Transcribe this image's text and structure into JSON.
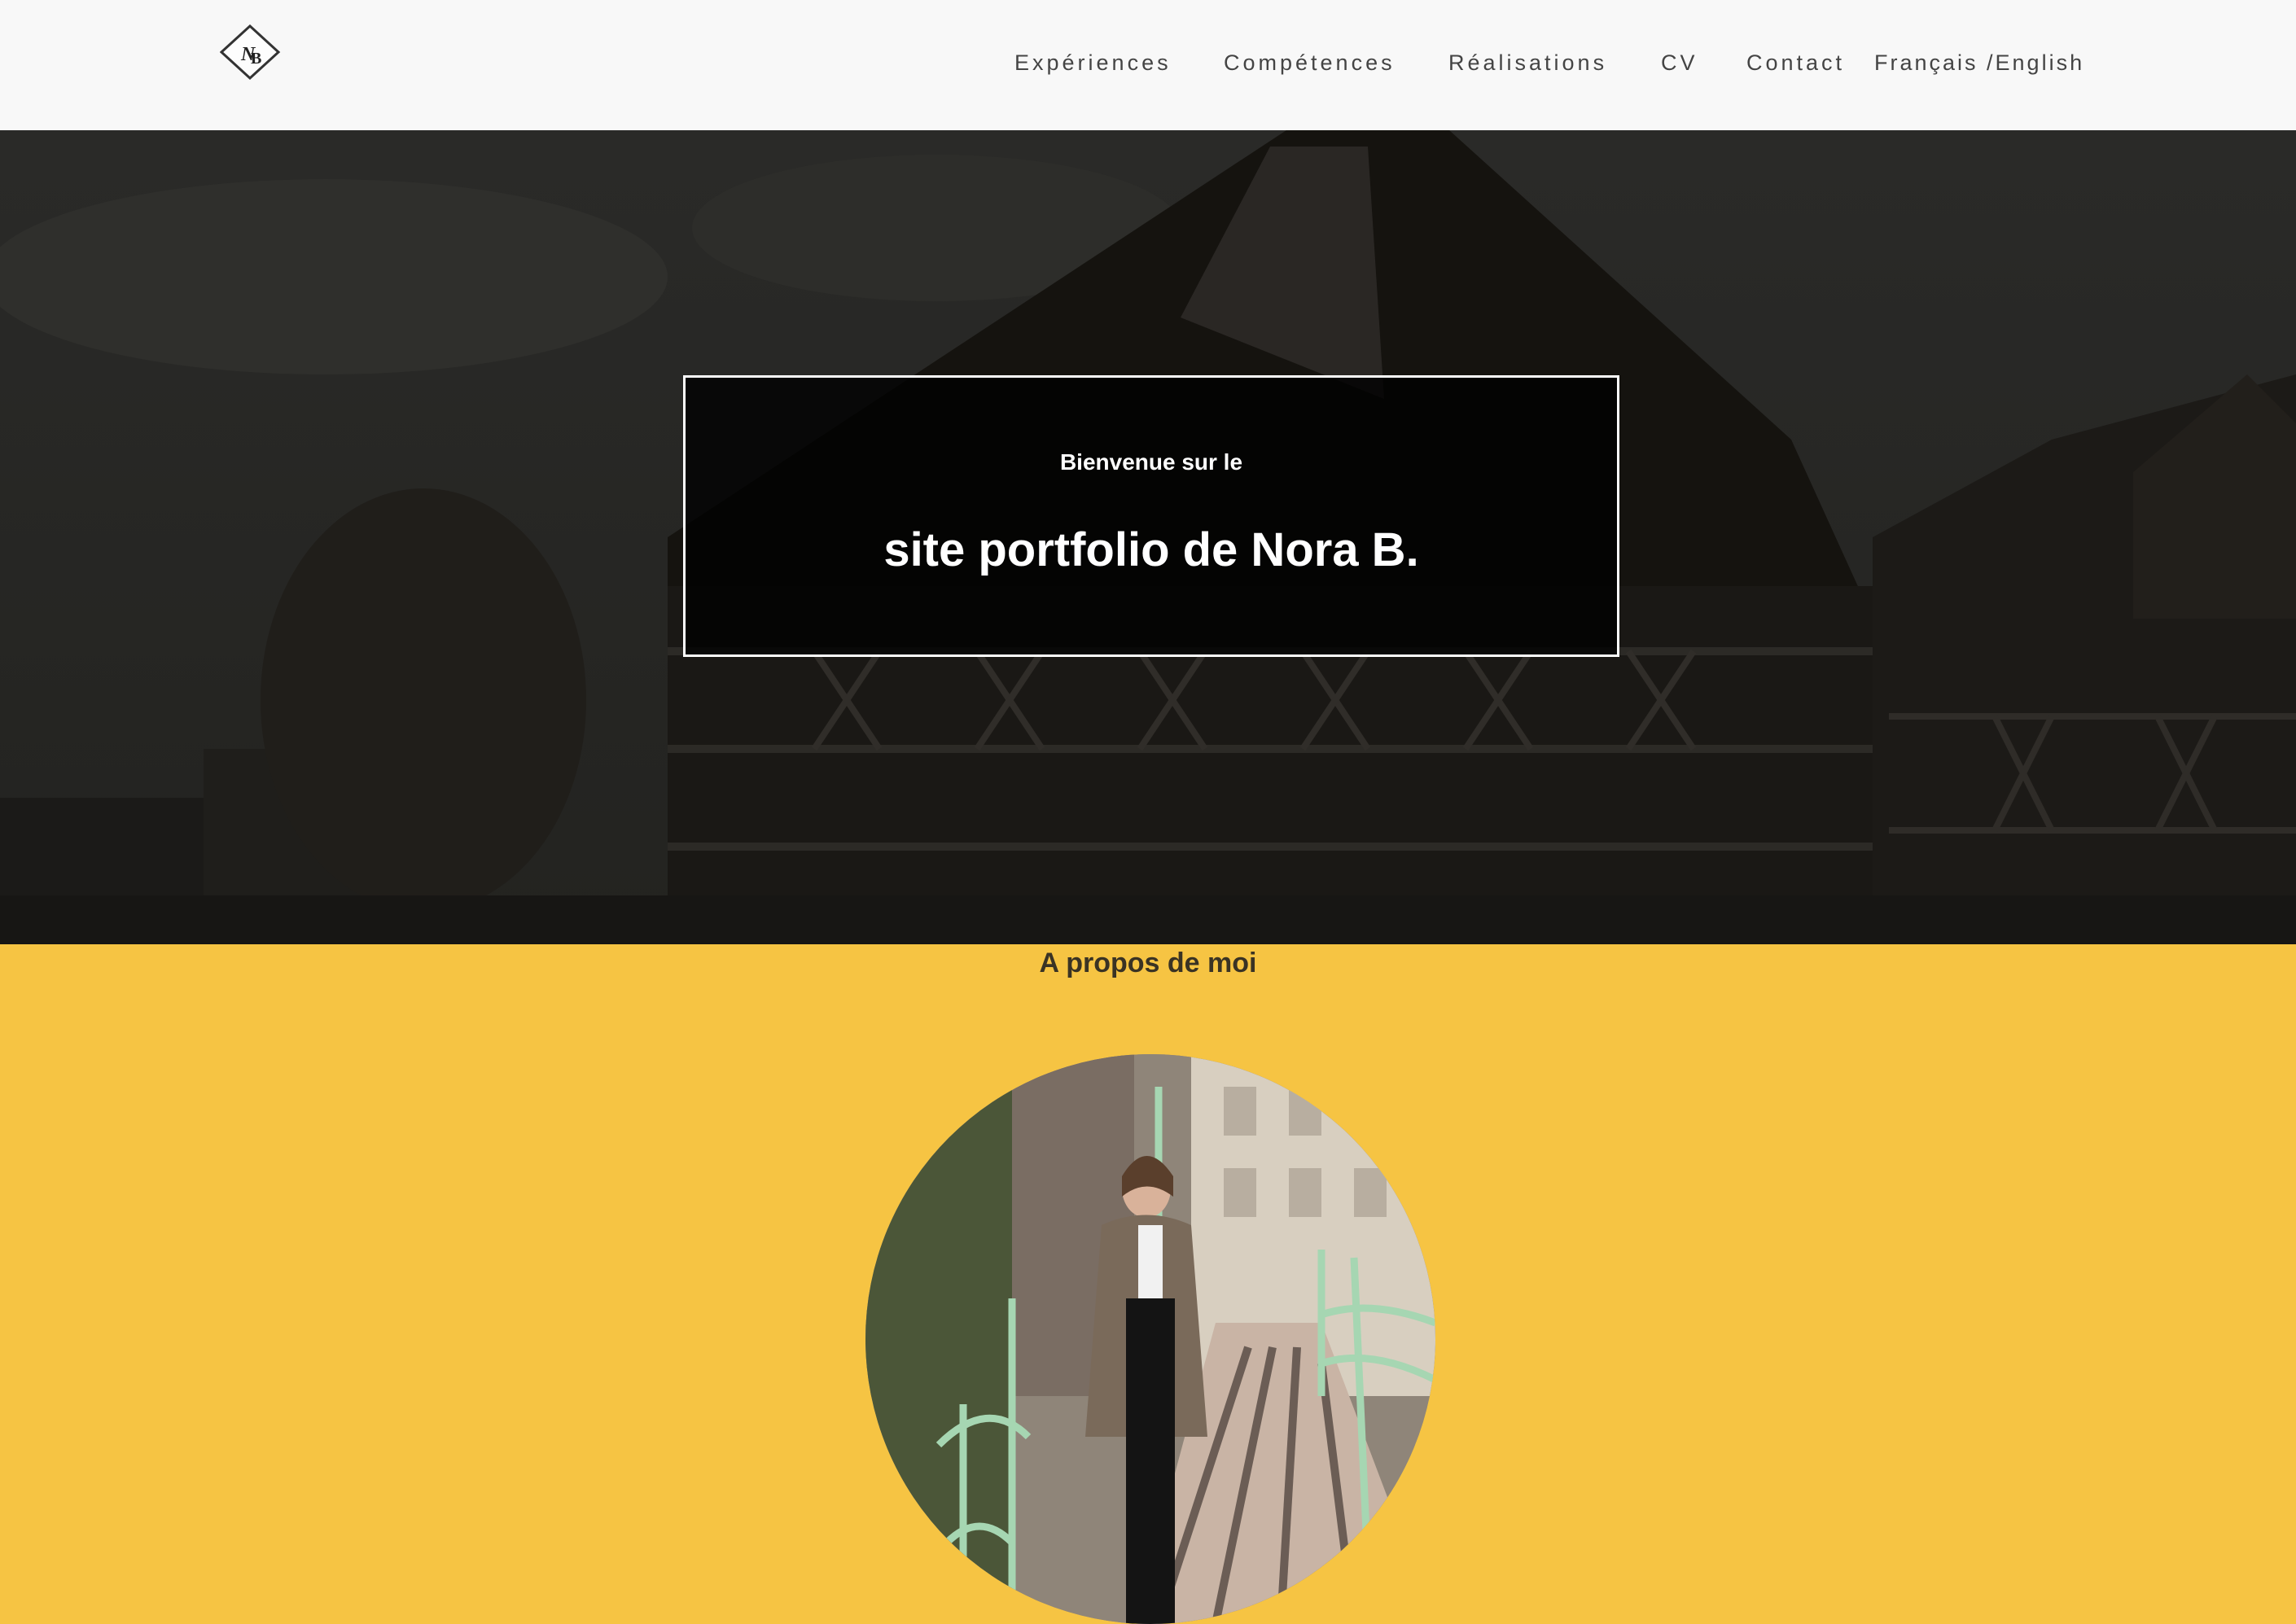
{
  "header": {
    "logo_icon": "nb-monogram-diamond-logo",
    "nav": {
      "experiences": "Expériences",
      "competences": "Compétences",
      "realisations": "Réalisations",
      "cv": "CV",
      "contact": "Contact",
      "language": "Français /English"
    }
  },
  "hero": {
    "background_icon": "half-timbered-houses-photo",
    "welcome_small": "Bienvenue sur le",
    "welcome_big": "site portfolio de Nora B."
  },
  "about": {
    "title": "A propos de moi",
    "portrait_icon": "profile-photo",
    "background_color": "#f6c443"
  }
}
